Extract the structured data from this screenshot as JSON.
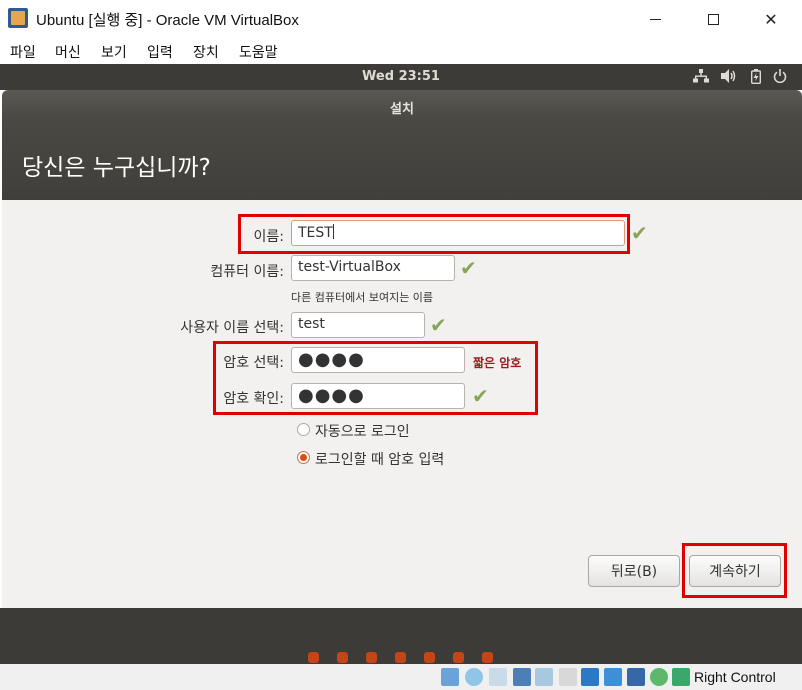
{
  "window": {
    "title": "Ubuntu [실행 중] - Oracle VM VirtualBox",
    "minimize_glyph": "",
    "close_glyph": "✕"
  },
  "vbox_menu": [
    "파일",
    "머신",
    "보기",
    "입력",
    "장치",
    "도움말"
  ],
  "ubuntu_panel": {
    "clock": "Wed 23:51",
    "tray_icons": [
      "network-icon",
      "volume-icon",
      "battery-icon",
      "power-icon"
    ]
  },
  "installer": {
    "window_title": "설치",
    "heading": "당신은 누구십니까?",
    "form": {
      "name_label": "이름:",
      "name_value": "TEST",
      "computer_label": "컴퓨터 이름:",
      "computer_value": "test-VirtualBox",
      "computer_hint": "다른 컴퓨터에서 보여지는 이름",
      "username_label": "사용자 이름 선택:",
      "username_value": "test",
      "password_label": "암호 선택:",
      "password_value": "●●●●",
      "password_warning": "짧은 암호",
      "confirm_label": "암호 확인:",
      "confirm_value": "●●●●",
      "autologin_label": "자동으로 로그인",
      "require_password_label": "로그인할 때 암호 입력",
      "selected_option": "require_password"
    },
    "buttons": {
      "back": "뒤로(B)",
      "continue": "계속하기"
    },
    "progress": {
      "total_steps": 7
    }
  },
  "statusbar": {
    "host_key": "Right Control"
  },
  "colors": {
    "accent": "#dd4814",
    "highlight_box": "#e00000",
    "check": "#87a556",
    "panel": "#3c3b37"
  }
}
